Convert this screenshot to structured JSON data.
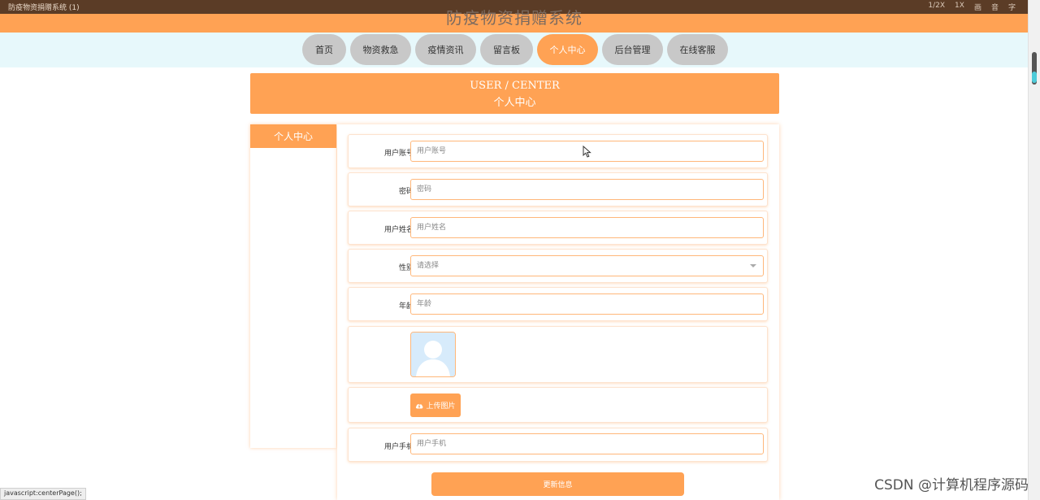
{
  "window": {
    "title": "防疫物资捐赠系统 (1)",
    "controls": [
      "1/2X",
      "1X",
      "画",
      "音",
      "字"
    ]
  },
  "site": {
    "title": "防疫物资捐赠系统"
  },
  "nav": {
    "items": [
      {
        "label": "首页",
        "active": false
      },
      {
        "label": "物资救急",
        "active": false
      },
      {
        "label": "疫情资讯",
        "active": false
      },
      {
        "label": "留言板",
        "active": false
      },
      {
        "label": "个人中心",
        "active": true
      },
      {
        "label": "后台管理",
        "active": false
      },
      {
        "label": "在线客服",
        "active": false
      }
    ]
  },
  "banner": {
    "en": "USER / CENTER",
    "zh": "个人中心"
  },
  "sidebar": {
    "title": "个人中心"
  },
  "form": {
    "account": {
      "label": "用户账号",
      "placeholder": "用户账号"
    },
    "password": {
      "label": "密码",
      "placeholder": "密码"
    },
    "name": {
      "label": "用户姓名",
      "placeholder": "用户姓名"
    },
    "gender": {
      "label": "性别",
      "placeholder": "请选择"
    },
    "age": {
      "label": "年龄",
      "placeholder": "年龄"
    },
    "upload": {
      "label": "上传图片"
    },
    "phone": {
      "label": "用户手机",
      "placeholder": "用户手机"
    },
    "submit": {
      "label": "更新信息"
    }
  },
  "status_bar": {
    "text": "javascript:centerPage();"
  },
  "watermark": {
    "text": "CSDN @计算机程序源码"
  },
  "colors": {
    "accent": "#ffa254",
    "nav_bg": "#e7f8fb",
    "nav_inactive": "#c8c8c8"
  }
}
